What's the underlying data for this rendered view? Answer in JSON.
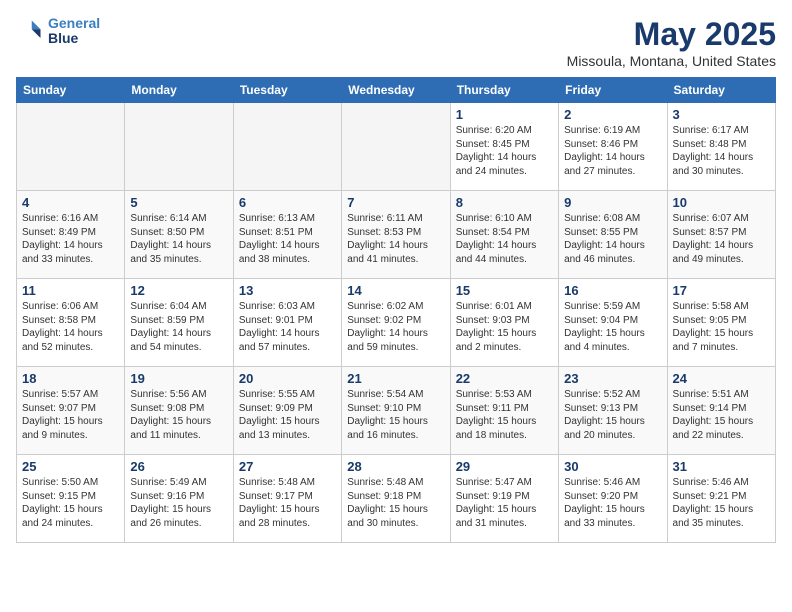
{
  "logo": {
    "line1": "General",
    "line2": "Blue"
  },
  "title": "May 2025",
  "location": "Missoula, Montana, United States",
  "weekdays": [
    "Sunday",
    "Monday",
    "Tuesday",
    "Wednesday",
    "Thursday",
    "Friday",
    "Saturday"
  ],
  "weeks": [
    [
      {
        "day": "",
        "info": ""
      },
      {
        "day": "",
        "info": ""
      },
      {
        "day": "",
        "info": ""
      },
      {
        "day": "",
        "info": ""
      },
      {
        "day": "1",
        "info": "Sunrise: 6:20 AM\nSunset: 8:45 PM\nDaylight: 14 hours\nand 24 minutes."
      },
      {
        "day": "2",
        "info": "Sunrise: 6:19 AM\nSunset: 8:46 PM\nDaylight: 14 hours\nand 27 minutes."
      },
      {
        "day": "3",
        "info": "Sunrise: 6:17 AM\nSunset: 8:48 PM\nDaylight: 14 hours\nand 30 minutes."
      }
    ],
    [
      {
        "day": "4",
        "info": "Sunrise: 6:16 AM\nSunset: 8:49 PM\nDaylight: 14 hours\nand 33 minutes."
      },
      {
        "day": "5",
        "info": "Sunrise: 6:14 AM\nSunset: 8:50 PM\nDaylight: 14 hours\nand 35 minutes."
      },
      {
        "day": "6",
        "info": "Sunrise: 6:13 AM\nSunset: 8:51 PM\nDaylight: 14 hours\nand 38 minutes."
      },
      {
        "day": "7",
        "info": "Sunrise: 6:11 AM\nSunset: 8:53 PM\nDaylight: 14 hours\nand 41 minutes."
      },
      {
        "day": "8",
        "info": "Sunrise: 6:10 AM\nSunset: 8:54 PM\nDaylight: 14 hours\nand 44 minutes."
      },
      {
        "day": "9",
        "info": "Sunrise: 6:08 AM\nSunset: 8:55 PM\nDaylight: 14 hours\nand 46 minutes."
      },
      {
        "day": "10",
        "info": "Sunrise: 6:07 AM\nSunset: 8:57 PM\nDaylight: 14 hours\nand 49 minutes."
      }
    ],
    [
      {
        "day": "11",
        "info": "Sunrise: 6:06 AM\nSunset: 8:58 PM\nDaylight: 14 hours\nand 52 minutes."
      },
      {
        "day": "12",
        "info": "Sunrise: 6:04 AM\nSunset: 8:59 PM\nDaylight: 14 hours\nand 54 minutes."
      },
      {
        "day": "13",
        "info": "Sunrise: 6:03 AM\nSunset: 9:01 PM\nDaylight: 14 hours\nand 57 minutes."
      },
      {
        "day": "14",
        "info": "Sunrise: 6:02 AM\nSunset: 9:02 PM\nDaylight: 14 hours\nand 59 minutes."
      },
      {
        "day": "15",
        "info": "Sunrise: 6:01 AM\nSunset: 9:03 PM\nDaylight: 15 hours\nand 2 minutes."
      },
      {
        "day": "16",
        "info": "Sunrise: 5:59 AM\nSunset: 9:04 PM\nDaylight: 15 hours\nand 4 minutes."
      },
      {
        "day": "17",
        "info": "Sunrise: 5:58 AM\nSunset: 9:05 PM\nDaylight: 15 hours\nand 7 minutes."
      }
    ],
    [
      {
        "day": "18",
        "info": "Sunrise: 5:57 AM\nSunset: 9:07 PM\nDaylight: 15 hours\nand 9 minutes."
      },
      {
        "day": "19",
        "info": "Sunrise: 5:56 AM\nSunset: 9:08 PM\nDaylight: 15 hours\nand 11 minutes."
      },
      {
        "day": "20",
        "info": "Sunrise: 5:55 AM\nSunset: 9:09 PM\nDaylight: 15 hours\nand 13 minutes."
      },
      {
        "day": "21",
        "info": "Sunrise: 5:54 AM\nSunset: 9:10 PM\nDaylight: 15 hours\nand 16 minutes."
      },
      {
        "day": "22",
        "info": "Sunrise: 5:53 AM\nSunset: 9:11 PM\nDaylight: 15 hours\nand 18 minutes."
      },
      {
        "day": "23",
        "info": "Sunrise: 5:52 AM\nSunset: 9:13 PM\nDaylight: 15 hours\nand 20 minutes."
      },
      {
        "day": "24",
        "info": "Sunrise: 5:51 AM\nSunset: 9:14 PM\nDaylight: 15 hours\nand 22 minutes."
      }
    ],
    [
      {
        "day": "25",
        "info": "Sunrise: 5:50 AM\nSunset: 9:15 PM\nDaylight: 15 hours\nand 24 minutes."
      },
      {
        "day": "26",
        "info": "Sunrise: 5:49 AM\nSunset: 9:16 PM\nDaylight: 15 hours\nand 26 minutes."
      },
      {
        "day": "27",
        "info": "Sunrise: 5:48 AM\nSunset: 9:17 PM\nDaylight: 15 hours\nand 28 minutes."
      },
      {
        "day": "28",
        "info": "Sunrise: 5:48 AM\nSunset: 9:18 PM\nDaylight: 15 hours\nand 30 minutes."
      },
      {
        "day": "29",
        "info": "Sunrise: 5:47 AM\nSunset: 9:19 PM\nDaylight: 15 hours\nand 31 minutes."
      },
      {
        "day": "30",
        "info": "Sunrise: 5:46 AM\nSunset: 9:20 PM\nDaylight: 15 hours\nand 33 minutes."
      },
      {
        "day": "31",
        "info": "Sunrise: 5:46 AM\nSunset: 9:21 PM\nDaylight: 15 hours\nand 35 minutes."
      }
    ]
  ]
}
